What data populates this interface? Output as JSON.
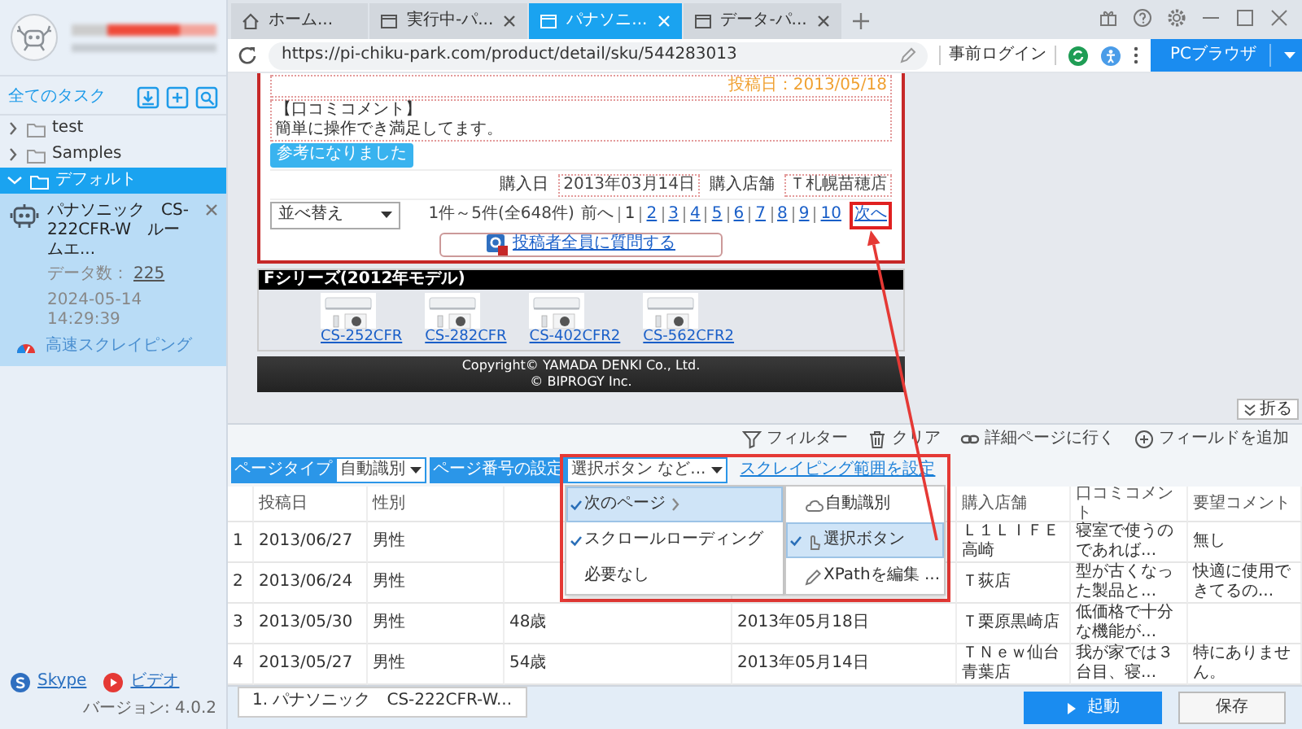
{
  "sidebar": {
    "title": "全てのタスク",
    "tree": [
      {
        "label": "test",
        "expanded": false,
        "selected": false
      },
      {
        "label": "Samples",
        "expanded": false,
        "selected": false
      },
      {
        "label": "デフォルト",
        "expanded": true,
        "selected": true,
        "children": [
          {
            "title": "パナソニック　CS-222CFR-W　ルームエ...",
            "count_label": "データ数：",
            "count": "225",
            "time": "2024-05-14 14:29:39",
            "mode": "高速スクレイピング"
          }
        ]
      }
    ],
    "links": [
      {
        "kind": "skype",
        "label": "Skype"
      },
      {
        "kind": "video",
        "label": "ビデオ"
      }
    ],
    "version": "バージョン: 4.0.2"
  },
  "browser": {
    "tabs": [
      {
        "kind": "home",
        "label": "ホーム...",
        "closable": false,
        "selected": false
      },
      {
        "kind": "page",
        "label": "実行中-パ...",
        "closable": true,
        "selected": false
      },
      {
        "kind": "page",
        "label": "パナソニ...",
        "closable": true,
        "selected": true
      },
      {
        "kind": "page",
        "label": "データ-パ...",
        "closable": true,
        "selected": false
      }
    ],
    "url": "https://pi-chiku-park.com/product/detail/sku/544283013",
    "login_button": "事前ログイン",
    "mode_button": "PCブラウザ"
  },
  "page": {
    "posted": "投稿日：2013/05/18",
    "comment_heading": "【口コミコメント】",
    "comment": "簡単に操作でき満足してます。",
    "helpful_button": "参考になりました",
    "purchase": [
      {
        "label": "購入日",
        "value": "2013年03月14日"
      },
      {
        "label": "購入店舗",
        "value": "Ｔ札幌苗穂店"
      }
    ],
    "sort": "並べ替え",
    "range": "1件～5件(全648件)",
    "prev": "前へ",
    "pages": [
      {
        "label": "1",
        "selected": true
      },
      {
        "label": "2",
        "selected": false
      },
      {
        "label": "3",
        "selected": false
      },
      {
        "label": "4",
        "selected": false
      },
      {
        "label": "5",
        "selected": false
      },
      {
        "label": "6",
        "selected": false
      },
      {
        "label": "7",
        "selected": false
      },
      {
        "label": "8",
        "selected": false
      },
      {
        "label": "9",
        "selected": false
      },
      {
        "label": "10",
        "selected": false
      }
    ],
    "next": "次へ",
    "ask_button": "投稿者全員に質問する",
    "series_title": "Fシリーズ(2012年モデル)",
    "products": [
      {
        "name": "CS-252CFR"
      },
      {
        "name": "CS-282CFR"
      },
      {
        "name": "CS-402CFR2"
      },
      {
        "name": "CS-562CFR2"
      }
    ],
    "footer": [
      "Copyright© YAMADA DENKI Co., Ltd.",
      "© BIPROGY Inc."
    ],
    "collapse_button": "折る"
  },
  "panel": {
    "tools": [
      {
        "kind": "filter",
        "label": "フィルター"
      },
      {
        "kind": "clear",
        "label": "クリア"
      },
      {
        "kind": "detail",
        "label": "詳細ページに行く"
      },
      {
        "kind": "add",
        "label": "フィールドを追加"
      }
    ],
    "page_type_label": "ページタイプ",
    "page_type": "自動識別",
    "page_number_label": "ページ番号の設定",
    "page_number": "選択ボタン など...",
    "range_link": "スクレイピング範囲を設定",
    "menu": [
      {
        "label": "次のページ",
        "checked": true,
        "selected": true,
        "submenu": true
      },
      {
        "label": "スクロールローディング",
        "checked": true,
        "selected": false,
        "submenu": false
      },
      {
        "label": "必要なし",
        "checked": false,
        "selected": false,
        "submenu": false
      }
    ],
    "submenu": [
      {
        "kind": "auto",
        "label": "自動識別",
        "checked": false,
        "selected": false
      },
      {
        "kind": "click",
        "label": "選択ボタン",
        "checked": true,
        "selected": true
      },
      {
        "kind": "edit",
        "label": "XPathを編集 ...",
        "checked": false,
        "selected": false
      }
    ]
  },
  "table": {
    "columns": [
      null,
      "投稿日",
      "性別",
      null,
      null,
      "購入店舗",
      "口コミコメント",
      "要望コメント"
    ],
    "rows": [
      [
        "1",
        "2013/06/27",
        "男性",
        null,
        null,
        "Ｌ１ＬＩＦＥ高崎",
        "寝室で使うのであれば...",
        "無し"
      ],
      [
        "2",
        "2013/06/24",
        "男性",
        null,
        null,
        "Ｔ荻店",
        "型が古くなった製品と...",
        "快適に使用できてるの..."
      ],
      [
        "3",
        "2013/05/30",
        "男性",
        "48歳",
        "2013年05月18日",
        "Ｔ栗原黒崎店",
        "低価格で十分な機能が...",
        null
      ],
      [
        "4",
        "2013/05/27",
        "男性",
        "54歳",
        "2013年05月14日",
        "ＴＮｅｗ仙台青葉店",
        "我が家では３台目、寝...",
        "特にありません。"
      ]
    ]
  },
  "bottom": {
    "task_tab": "1. パナソニック　CS-222CFR-W...",
    "start_button": "起動",
    "save_button": "保存"
  }
}
